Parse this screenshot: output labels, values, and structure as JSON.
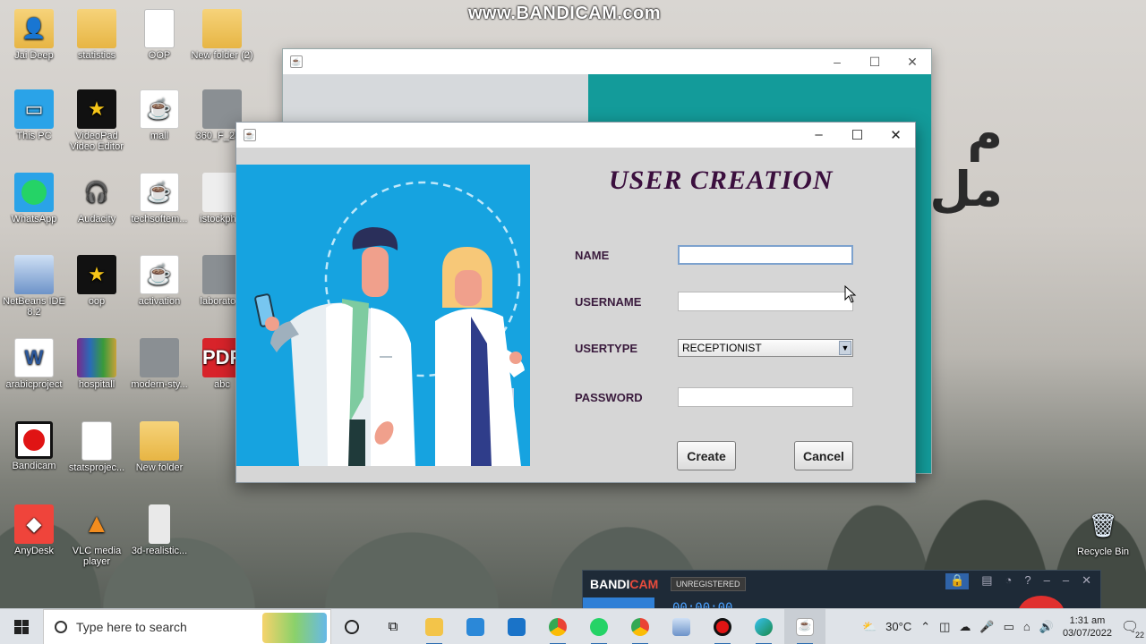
{
  "watermark": "www.BANDICAM.com",
  "background_text": [
    "م",
    "مل ك"
  ],
  "desktop_icons": [
    {
      "label": "Jai Deep",
      "icon": "folder-person-icon"
    },
    {
      "label": "statistics",
      "icon": "folder-icon"
    },
    {
      "label": "OOP",
      "icon": "document-icon"
    },
    {
      "label": "New folder (2)",
      "icon": "folder-icon"
    },
    {
      "label": "This PC",
      "icon": "computer-icon"
    },
    {
      "label": "VideoPad Video Editor",
      "icon": "star-app-icon"
    },
    {
      "label": "mall",
      "icon": "java-file-icon"
    },
    {
      "label": "360_F_25...",
      "icon": "image-icon"
    },
    {
      "label": "WhatsApp",
      "icon": "whatsapp-icon"
    },
    {
      "label": "Audacity",
      "icon": "audacity-icon"
    },
    {
      "label": "techsoftem...",
      "icon": "java-file-icon"
    },
    {
      "label": "istockph...",
      "icon": "image-icon"
    },
    {
      "label": "NetBeans IDE 8.2",
      "icon": "netbeans-icon"
    },
    {
      "label": "oop",
      "icon": "star-app-icon"
    },
    {
      "label": "activation",
      "icon": "java-file-icon"
    },
    {
      "label": "laborato...",
      "icon": "image-icon"
    },
    {
      "label": "arabicproject",
      "icon": "word-doc-icon"
    },
    {
      "label": "hospitall",
      "icon": "winrar-icon"
    },
    {
      "label": "modern-sty...",
      "icon": "image-icon"
    },
    {
      "label": "abc",
      "icon": "pdf-icon"
    },
    {
      "label": "Bandicam",
      "icon": "bandicam-icon"
    },
    {
      "label": "statsprojec...",
      "icon": "document-icon"
    },
    {
      "label": "New folder",
      "icon": "folder-icon"
    },
    {
      "label": "AnyDesk",
      "icon": "anydesk-icon"
    },
    {
      "label": "VLC media player",
      "icon": "vlc-icon"
    },
    {
      "label": "3d-realistic...",
      "icon": "image-icon"
    }
  ],
  "recycle_bin": "Recycle Bin",
  "window": {
    "minimize": "–",
    "maximize": "☐",
    "close": "✕",
    "title": "USER CREATION",
    "fields": {
      "name_label": "NAME",
      "name_value": "",
      "username_label": "USERNAME",
      "username_value": "",
      "usertype_label": "USERTYPE",
      "usertype_value": "RECEPTIONIST",
      "password_label": "PASSWORD",
      "password_value": ""
    },
    "buttons": {
      "create": "Create",
      "cancel": "Cancel"
    }
  },
  "bandicam": {
    "logo_a": "BANDI",
    "logo_b": "CAM",
    "unregistered": "UNREGISTERED",
    "timer": "00:00:00",
    "help": "?"
  },
  "taskbar": {
    "search_placeholder": "Type here to search",
    "weather": "30°C",
    "time": "1:31 am",
    "date": "03/07/2022",
    "notifications": "22"
  }
}
